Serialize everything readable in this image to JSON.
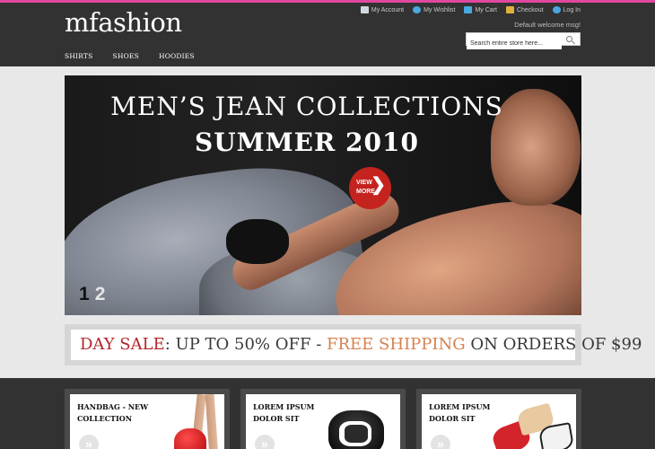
{
  "site": {
    "logo": "mfashion",
    "accent_color": "#e0479e"
  },
  "toplinks": [
    {
      "label": "My Account",
      "icon": "account-icon",
      "color": "#cfd8e3"
    },
    {
      "label": "My Wishlist",
      "icon": "wishlist-icon",
      "color": "#4aa8e0"
    },
    {
      "label": "My Cart",
      "icon": "cart-icon",
      "color": "#4aa8e0"
    },
    {
      "label": "Checkout",
      "icon": "checkout-icon",
      "color": "#e0b040"
    },
    {
      "label": "Log In",
      "icon": "login-icon",
      "color": "#4aa8e0"
    }
  ],
  "welcome": "Default welcome msg!",
  "search": {
    "placeholder": "Search entire store here...",
    "icon": "search-icon"
  },
  "nav": [
    "SHIRTS",
    "SHOES",
    "HOODIES"
  ],
  "banner": {
    "title": "MEN’S JEAN COLLECTIONS",
    "subtitle": "SUMMER 2010",
    "cta_line1": "VIEW",
    "cta_line2": "MORE",
    "cta_arrow": "❯",
    "pages": [
      "1",
      "2"
    ],
    "cta_color": "#c4231e"
  },
  "sale": {
    "part1": "DAY SALE",
    "part2": ": UP TO 50% OFF - ",
    "part3": "FREE SHIPPING",
    "part4": " ON ORDERS OF $99"
  },
  "cards": [
    {
      "title": "HANDBAG - NEW COLLECTION",
      "button": "»"
    },
    {
      "title": "LOREM IPSUM DOLOR SIT",
      "button": "»"
    },
    {
      "title": "LOREM IPSUM DOLOR SIT",
      "button": "»"
    }
  ]
}
